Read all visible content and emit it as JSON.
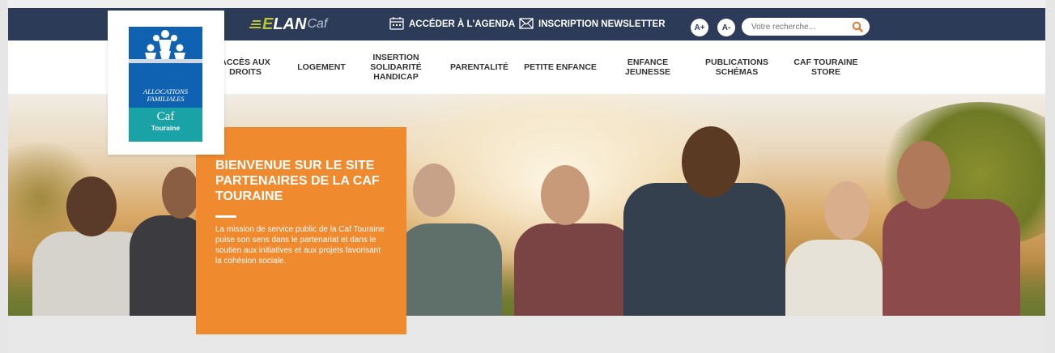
{
  "brand": {
    "elan_e": "E",
    "elan_lan": "LAN",
    "elan_caf": "Caf",
    "logo_line1": "ALLOCATIONS",
    "logo_line2": "FAMILIALES",
    "logo_caf": "Caf",
    "logo_region": "Touraine"
  },
  "topbar": {
    "agenda_label": "ACCÉDER À L'AGENDA",
    "newsletter_label": "INSCRIPTION NEWSLETTER",
    "font_increase": "A+",
    "font_decrease": "A-",
    "search_placeholder": "Votre recherche..."
  },
  "nav": {
    "items": [
      {
        "label": "ACCÈS AUX\nDROITS"
      },
      {
        "label": "LOGEMENT"
      },
      {
        "label": "INSERTION\nSOLIDARITÉ\nHANDICAP"
      },
      {
        "label": "PARENTALITÉ"
      },
      {
        "label": "PETITE ENFANCE"
      },
      {
        "label": "ENFANCE\nJEUNESSE"
      },
      {
        "label": "PUBLICATIONS\nSCHÉMAS"
      },
      {
        "label": "CAF TOURAINE\nSTORE"
      }
    ]
  },
  "hero": {
    "title": "BIENVENUE SUR LE SITE PARTENAIRES DE LA CAF TOURAINE",
    "text": "La mission de service public de la Caf Touraine puise son sens dans le partenariat et dans le soutien aux initiatives et aux projets favorisant la cohésion sociale."
  },
  "colors": {
    "topbar": "#2c3b57",
    "accent_orange": "#ef8a2f",
    "elan_green": "#b9c43a",
    "search_icon": "#e8792a",
    "logo_blue": "#0f62b2",
    "logo_teal": "#1aa3a6"
  },
  "icons": {
    "agenda": "calendar-icon",
    "newsletter": "envelope-icon",
    "search": "search-icon"
  }
}
